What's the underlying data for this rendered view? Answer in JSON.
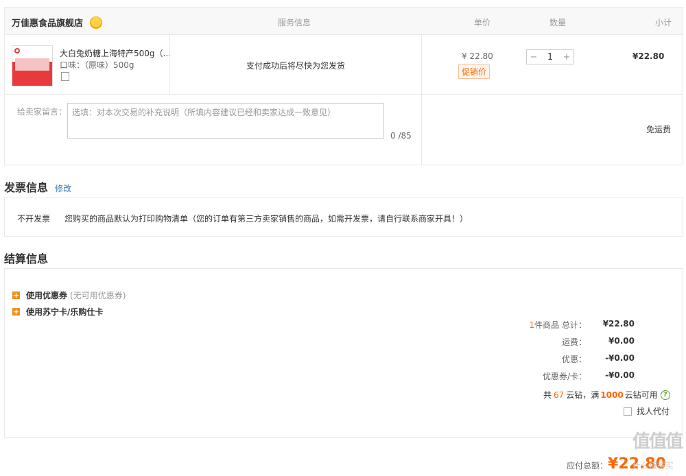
{
  "order": {
    "store_name": "万佳惠食品旗舰店",
    "col_service": "服务信息",
    "col_unit_price": "单价",
    "col_quantity": "数量",
    "col_subtotal": "小计",
    "product": {
      "title": "大白兔奶糖上海特产500g（...",
      "spec": "口味：（原味）500g",
      "service_text": "支付成功后将尽快为您发货",
      "unit_price": "¥ 22.80",
      "promo": "促销价",
      "quantity": "1",
      "minus": "−",
      "plus": "+",
      "subtotal": "¥22.80"
    },
    "message_label": "给卖家留言：",
    "message_placeholder": "选填：对本次交易的补充说明（所填内容建议已经和卖家达成一致意见）",
    "message_count": "0 /85",
    "shipping": "免运费"
  },
  "invoice": {
    "title": "发票信息",
    "edit": "修改",
    "type": "不开发票",
    "note": "您购买的商品默认为打印购物清单（您的订单有第三方卖家销售的商品，如需开发票，请自行联系商家开具！）"
  },
  "settlement": {
    "title": "结算信息",
    "coupon_label": "使用优惠券",
    "coupon_note": "(无可用优惠券)",
    "card_label": "使用苏宁卡/乐购仕卡",
    "summary": {
      "count": "1",
      "count_suffix": "件商品 总计：",
      "total": "¥22.80",
      "freight_label": "运费：",
      "freight": "¥0.00",
      "discount_label": "优惠：",
      "discount": "-¥0.00",
      "coupon_card_label": "优惠券/卡：",
      "coupon_card": "-¥0.00"
    },
    "yunzuan": {
      "prefix": "共",
      "amount": "67",
      "mid": "云钻，满",
      "threshold": "1000",
      "suffix": "云钻可用"
    },
    "proxy_pay": "找人代付",
    "payable_label": "应付总额：",
    "payable": "¥22.80"
  },
  "watermark": {
    "big": "值值值",
    "small": "什么值得买"
  }
}
